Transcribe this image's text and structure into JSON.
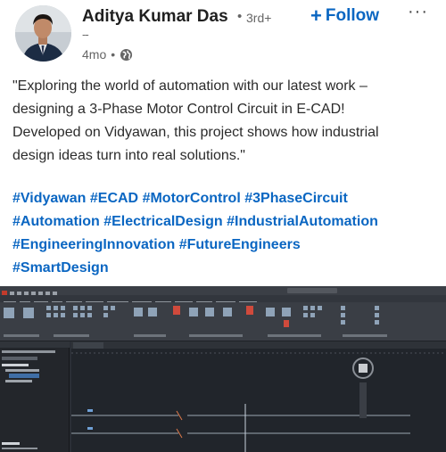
{
  "post": {
    "author": {
      "name": "Aditya Kumar Das",
      "connection_dot": "•",
      "degree": "3rd+",
      "subtitle": "--",
      "time": "4mo",
      "time_dot": "•"
    },
    "follow_label": "Follow",
    "follow_plus": "+",
    "more_label": "···",
    "text_lines": [
      "\"Exploring the world of automation with our latest work –",
      "designing a 3-Phase Motor Control Circuit in E-CAD!",
      "Developed on Vidyawan, this project shows how industrial",
      "design ideas turn into real solutions.\""
    ],
    "hashtag_lines": [
      [
        "#Vidyawan",
        "#ECAD",
        "#MotorControl",
        "#3PhaseCircuit"
      ],
      [
        "#Automation",
        "#ElectricalDesign",
        "#IndustrialAutomation"
      ],
      [
        "#EngineeringInnovation",
        "#FutureEngineers"
      ],
      [
        "#SmartDesign"
      ]
    ]
  },
  "colors": {
    "link_blue": "#0a66c2",
    "text_dark": "#1f1f1f",
    "meta_gray": "#666666",
    "cad_bg": "#21252b"
  },
  "icons": {
    "globe": "globe-icon",
    "more": "more-horizontal-icon",
    "plus": "plus-icon"
  }
}
